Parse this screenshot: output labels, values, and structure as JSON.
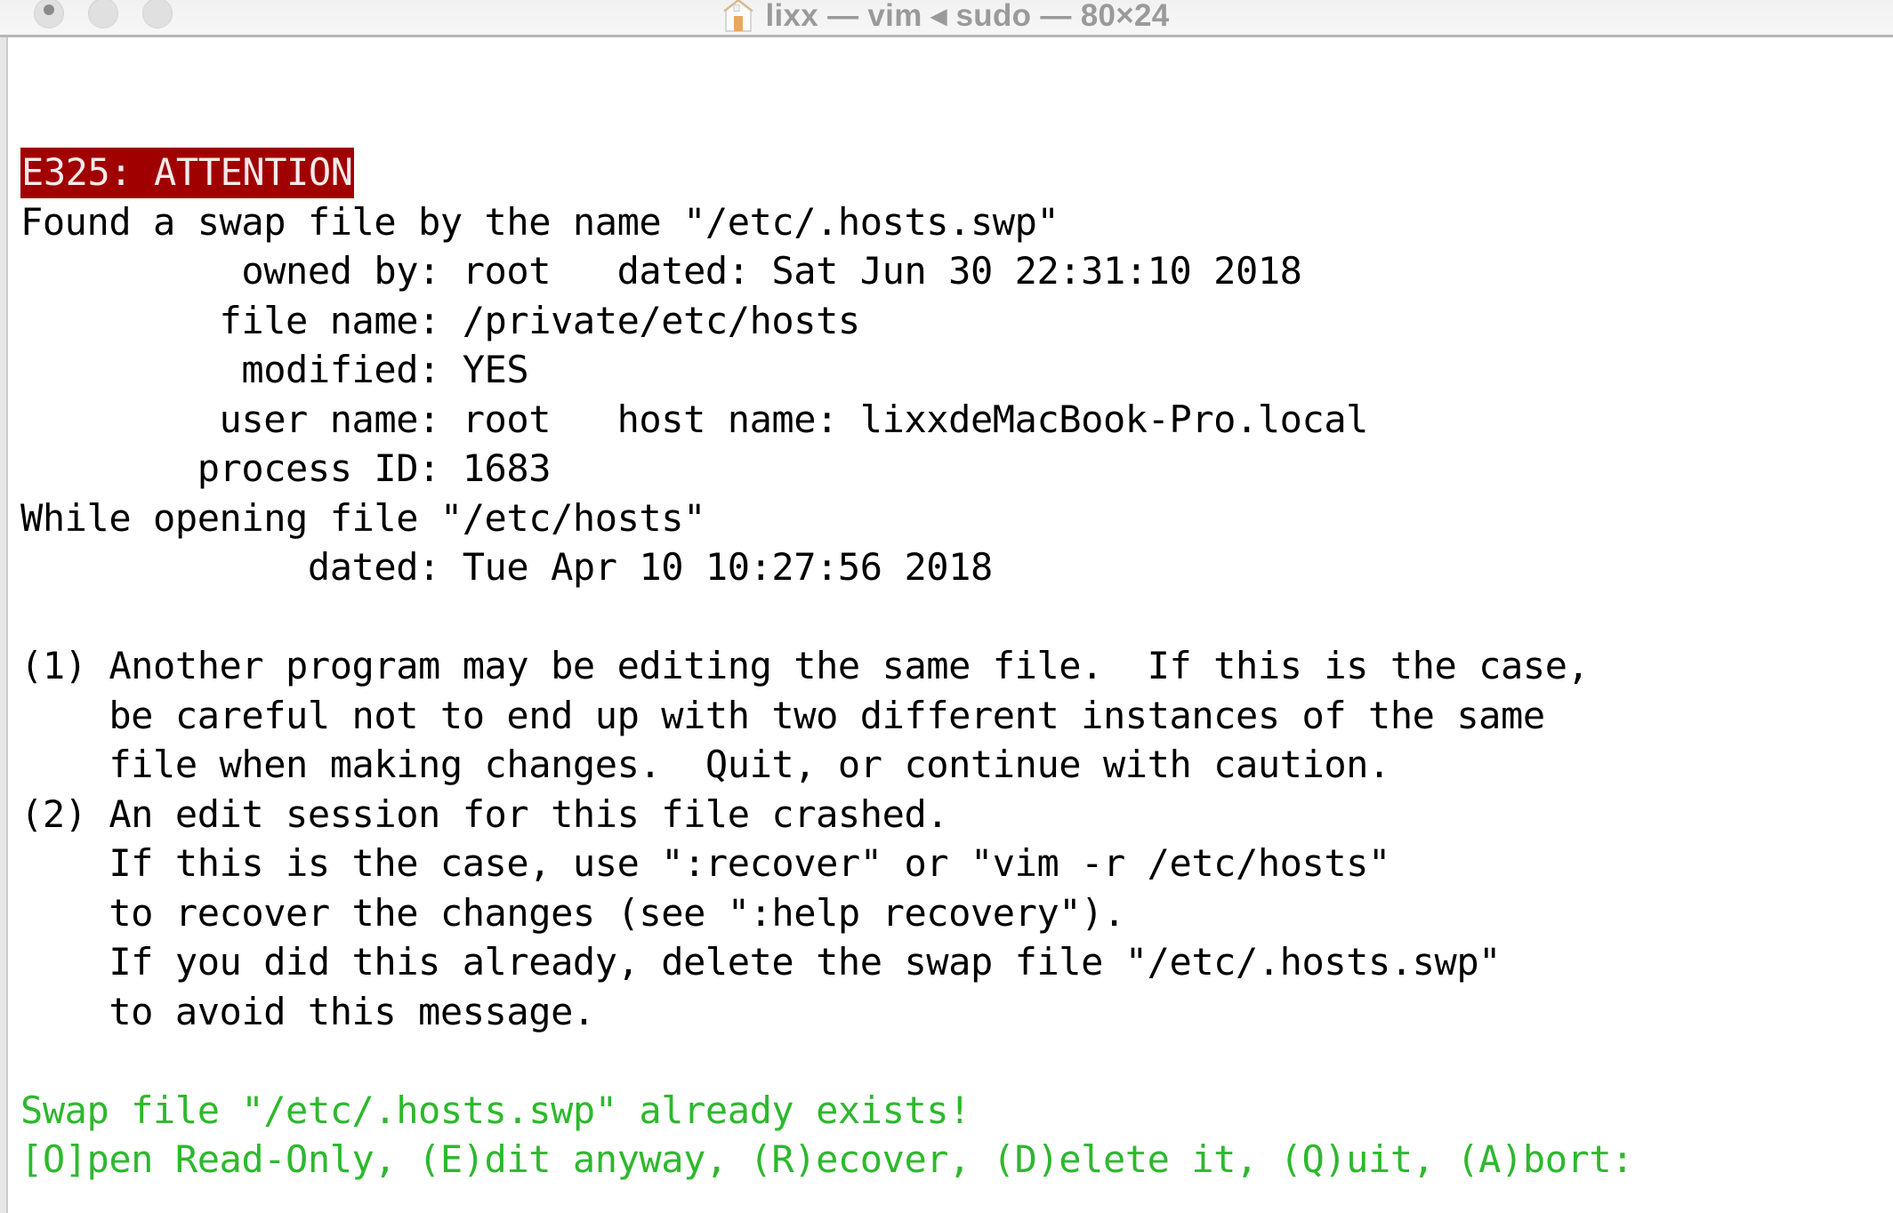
{
  "window": {
    "title": "lixx — vim ◂ sudo — 80×24",
    "title_icon": "home-folder-icon",
    "traffic_lights": {
      "close_label": "Close",
      "minimize_label": "Minimize",
      "zoom_label": "Zoom"
    },
    "state": "inactive",
    "terminal_size": "80×24"
  },
  "colors": {
    "titlebar_bg": "#f4f4f4",
    "title_text": "#9a9a9a",
    "terminal_bg": "#ffffff",
    "terminal_fg": "#000000",
    "error_bg": "#a00000",
    "error_fg": "#f2eaea",
    "green": "#2db82d"
  },
  "terminal": {
    "error_code": "E325: ATTENTION",
    "lines": {
      "found": "Found a swap file by the name \"/etc/.hosts.swp\"",
      "owned_dated": "          owned by: root   dated: Sat Jun 30 22:31:10 2018",
      "file_name": "         file name: /private/etc/hosts",
      "modified": "          modified: YES",
      "user_host": "         user name: root   host name: lixxdeMacBook-Pro.local",
      "process_id": "        process ID: 1683",
      "while_opening": "While opening file \"/etc/hosts\"",
      "opened_dated": "             dated: Tue Apr 10 10:27:56 2018",
      "item1_a": "(1) Another program may be editing the same file.  If this is the case,",
      "item1_b": "    be careful not to end up with two different instances of the same",
      "item1_c": "    file when making changes.  Quit, or continue with caution.",
      "item2_a": "(2) An edit session for this file crashed.",
      "item2_b": "    If this is the case, use \":recover\" or \"vim -r /etc/hosts\"",
      "item2_c": "    to recover the changes (see \":help recovery\").",
      "item2_d": "    If you did this already, delete the swap file \"/etc/.hosts.swp\"",
      "item2_e": "    to avoid this message.",
      "swap_exists": "Swap file \"/etc/.hosts.swp\" already exists!",
      "prompt": "[O]pen Read-Only, (E)dit anyway, (R)ecover, (D)elete it, (Q)uit, (A)bort:"
    }
  }
}
